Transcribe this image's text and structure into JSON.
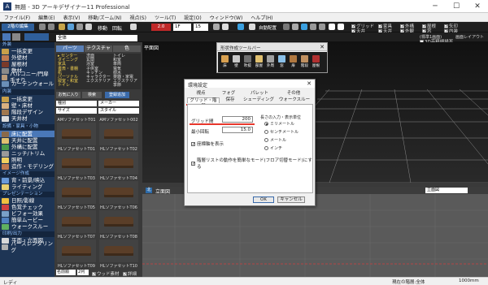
{
  "window": {
    "title": "無題 - 3D アーキデザイナー11 Professional",
    "minimize": "─",
    "maximize": "☐",
    "close": "✕"
  },
  "menu": [
    "ファイル(F)",
    "編集(E)",
    "表示(V)",
    "移動/ズーム(N)",
    "視点(S)",
    "ツール(T)",
    "設定(O)",
    "ウィンドウ(W)",
    "ヘルプ(H)"
  ],
  "toolbar": {
    "floor_edit": "2階の編集",
    "move": "移動",
    "rotate": "回転",
    "home": "2.0",
    "floor_select": "1F",
    "rotation_value": "15",
    "wall_shown": "壁面表示",
    "auto_arrange": "自動配置",
    "display_checks": [
      "グリッド",
      "家具",
      "天井",
      "外構",
      "天井",
      "家具",
      "外観",
      "屋根",
      "床",
      "窓",
      "内装",
      "矢印"
    ],
    "rendering_label": "(標準1画面)",
    "high_quality_3d": "3D高精細描写",
    "screen_layout": "画面レイアウト"
  },
  "sidebar": {
    "sections": [
      {
        "heading": "外装",
        "items": [
          "一括変更",
          "外壁材",
          "屋根材",
          "敷材",
          "バルコニー/門扉 手すり",
          "カーテンウォール"
        ]
      },
      {
        "heading": "内装",
        "items": [
          "一括変更",
          "壁・床材",
          "階段デザイン",
          "天井材"
        ]
      },
      {
        "heading": "設備・家具・小物",
        "items": [
          "床に配置",
          "天井に配置",
          "外構に配置",
          "ニッチ/トリム",
          "照明",
          "造作・モデリング"
        ]
      },
      {
        "heading": "イメージ作成",
        "items": [
          "背・前景/映込",
          "ライティング"
        ]
      },
      {
        "heading": "プレゼンテーション",
        "items": [
          "日照/影線",
          "色覚チェック",
          "ビフォー効果",
          "簡単ムービー",
          "ウォークスルー"
        ]
      },
      {
        "heading": "印刷/出力",
        "items": [
          "平面・立面図",
          "パースレンダリング"
        ]
      }
    ]
  },
  "catalog": {
    "category_select": "全体",
    "tabs": [
      "パーツ",
      "テクスチャ",
      "色"
    ],
    "tree_col1": [
      "▸ センター",
      "ダイニング",
      "家具",
      "書斎・書棚",
      "机",
      "パーソナル",
      "寝室・和室",
      "トイレ"
    ],
    "tree_col2": [
      "洗面",
      "玄関",
      "浴室",
      "子供室",
      "キッチン",
      "キャラクター",
      "エクステリア"
    ],
    "tree_col3": [
      "トイレ",
      "和室",
      "車両",
      "電気",
      "樹木",
      "楽器・家電",
      "エクステリア",
      "季節"
    ],
    "fav_label": "お気に入り",
    "search_label": "検索",
    "add_label": "登録追加",
    "filter1_left": "種別",
    "filter1_right": "メーカー",
    "filter2_left": "サイズ",
    "filter2_right": "スタイル",
    "items": [
      "AMソファセットT01",
      "AMソファセット002",
      "HLソファセットT01",
      "HLソファセットT02",
      "HLソファセットT03",
      "HLソファセットT04",
      "HLソファセットT05",
      "HLソファセットT06",
      "HLソファセットT07",
      "HLソファセットT08",
      "HLソファセットT09",
      "HLソファセットT10"
    ],
    "sort_select": "名前順",
    "page": "2列",
    "ipu_label": "ウッド素材",
    "check_label": "詳細"
  },
  "viewport": {
    "top_label": "平面図",
    "grid_labels": [
      "北",
      "立面図"
    ],
    "bottom_left_label": "北",
    "bottom_view_label": "立面図",
    "bottom_dropdown": "立面図"
  },
  "palette": {
    "title": "形状作成ツールバー",
    "buttons": [
      "床",
      "天井",
      "壁",
      "梁",
      "吹抜",
      "段差",
      "部屋",
      "外周",
      "窓",
      "扉",
      "室名",
      "階段",
      "手摺",
      "屋根",
      "文字",
      "寸法",
      "パーツ"
    ]
  },
  "dialog": {
    "title": "環境設定",
    "close": "✕",
    "tabs_row1": [
      "視点",
      "フォグ",
      "パレット",
      "その他"
    ],
    "tabs_row2": [
      "グリッド・階層",
      "保存",
      "シェーディング",
      "ウォークスルー"
    ],
    "grid_spacing_label": "グリッド間",
    "grid_spacing_value": "200",
    "min_rotation_label": "最小回転",
    "min_rotation_value": "15.0",
    "coord_display": "座標軸を表示",
    "units_title": "長さの入力・表示単位",
    "units": [
      "ミリメートル",
      "センチメートル",
      "メートル",
      "インチ"
    ],
    "layer_option": "階層リストの動作を簡単なモード(フロア切替モード)にする",
    "ok": "OK",
    "cancel": "キャンセル"
  },
  "status": {
    "left": "レディ",
    "right_floor": "現在の階層:全体",
    "right_unit": "1000mm"
  },
  "colors": {
    "accent": "#e8372c",
    "sidebar_bg": "#1e3555",
    "sidebar_active": "#4a78b8",
    "dialog_bg": "#f0f0f0"
  }
}
